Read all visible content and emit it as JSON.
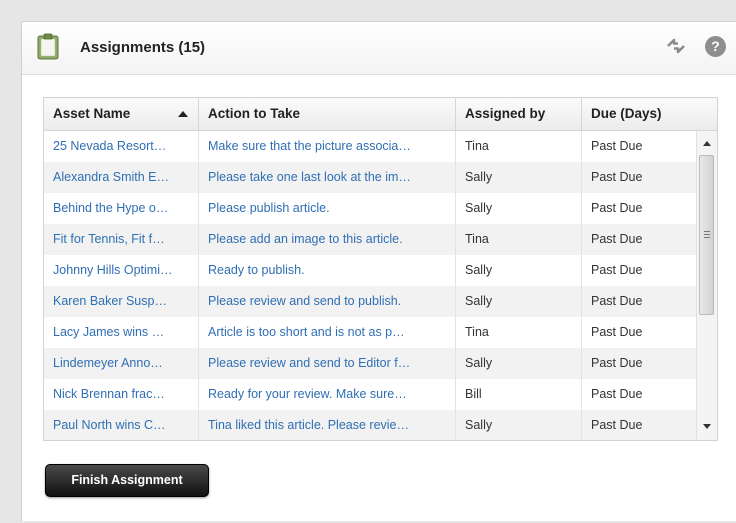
{
  "header": {
    "title": "Assignments (15)",
    "icons": {
      "clipboard": "clipboard-icon",
      "sync": "sync-icon",
      "help": "help-icon"
    },
    "help_glyph": "?"
  },
  "table": {
    "columns": [
      "Asset Name",
      "Action to Take",
      "Assigned by",
      "Due (Days)"
    ],
    "sort": {
      "column": "Asset Name",
      "direction": "ascending"
    },
    "rows": [
      {
        "asset": "25 Nevada Resort…",
        "action": "Make sure that the picture associa…",
        "assigned_by": "Tina",
        "due": "Past Due"
      },
      {
        "asset": "Alexandra Smith E…",
        "action": "Please take one last look at the im…",
        "assigned_by": "Sally",
        "due": "Past Due"
      },
      {
        "asset": "Behind the Hype o…",
        "action": "Please publish article.",
        "assigned_by": "Sally",
        "due": "Past Due"
      },
      {
        "asset": "Fit for Tennis, Fit f…",
        "action": "Please add an image to this article.",
        "assigned_by": "Tina",
        "due": "Past Due"
      },
      {
        "asset": "Johnny Hills Optimi…",
        "action": "Ready to publish.",
        "assigned_by": "Sally",
        "due": "Past Due"
      },
      {
        "asset": "Karen Baker Susp…",
        "action": "Please review and send to publish.",
        "assigned_by": "Sally",
        "due": "Past Due"
      },
      {
        "asset": "Lacy James wins …",
        "action": "Article is too short and is not as p…",
        "assigned_by": "Tina",
        "due": "Past Due"
      },
      {
        "asset": "Lindemeyer Anno…",
        "action": "Please review and send to Editor f…",
        "assigned_by": "Sally",
        "due": "Past Due"
      },
      {
        "asset": "Nick Brennan frac…",
        "action": "Ready for your review. Make sure…",
        "assigned_by": "Bill",
        "due": "Past Due"
      },
      {
        "asset": "Paul North wins C…",
        "action": "Tina liked this article. Please revie…",
        "assigned_by": "Sally",
        "due": "Past Due"
      }
    ]
  },
  "footer": {
    "finish_label": "Finish Assignment"
  },
  "colors": {
    "link": "#2f6fb3",
    "button": "#1a1a1a",
    "row_alt": "#f2f2f2"
  }
}
